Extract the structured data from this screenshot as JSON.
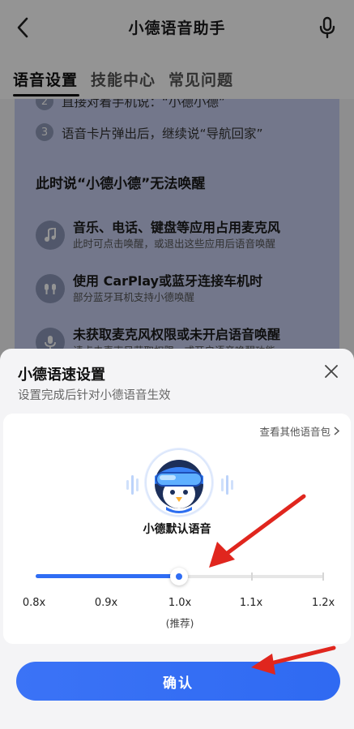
{
  "header": {
    "title": "小德语音助手"
  },
  "tabs": [
    {
      "label": "语音设置"
    },
    {
      "label": "技能中心"
    },
    {
      "label": "常见问题"
    }
  ],
  "content": {
    "step2": "直接对着手机说：“小德小德”",
    "step3_num": "3",
    "step3": "语音卡片弹出后，继续说“导航回家”",
    "section_title": "此时说“小德小德”无法唤醒",
    "features": [
      {
        "title": "音乐、电话、键盘等应用占用麦克风",
        "sub": "此时可点击唤醒，或退出这些应用后语音唤醒"
      },
      {
        "title": "使用 CarPlay或蓝牙连接车机时",
        "sub": "部分蓝牙耳机支持小德唤醒"
      },
      {
        "title": "未获取麦克风权限或未开启语音唤醒",
        "sub": "请点击麦克风获取权限，或开启语音唤醒功能"
      }
    ]
  },
  "sheet": {
    "title": "小德语速设置",
    "subtitle": "设置完成后针对小德语音生效",
    "other_link": "查看其他语音包",
    "voice_name": "小德默认语音",
    "speeds": [
      "0.8x",
      "0.9x",
      "1.0x",
      "1.1x",
      "1.2x"
    ],
    "selected_speed": "1.0x",
    "recommended": "(推荐)",
    "confirm": "确认"
  },
  "colors": {
    "accent": "#2f6df4",
    "arrow": "#e0261e"
  }
}
